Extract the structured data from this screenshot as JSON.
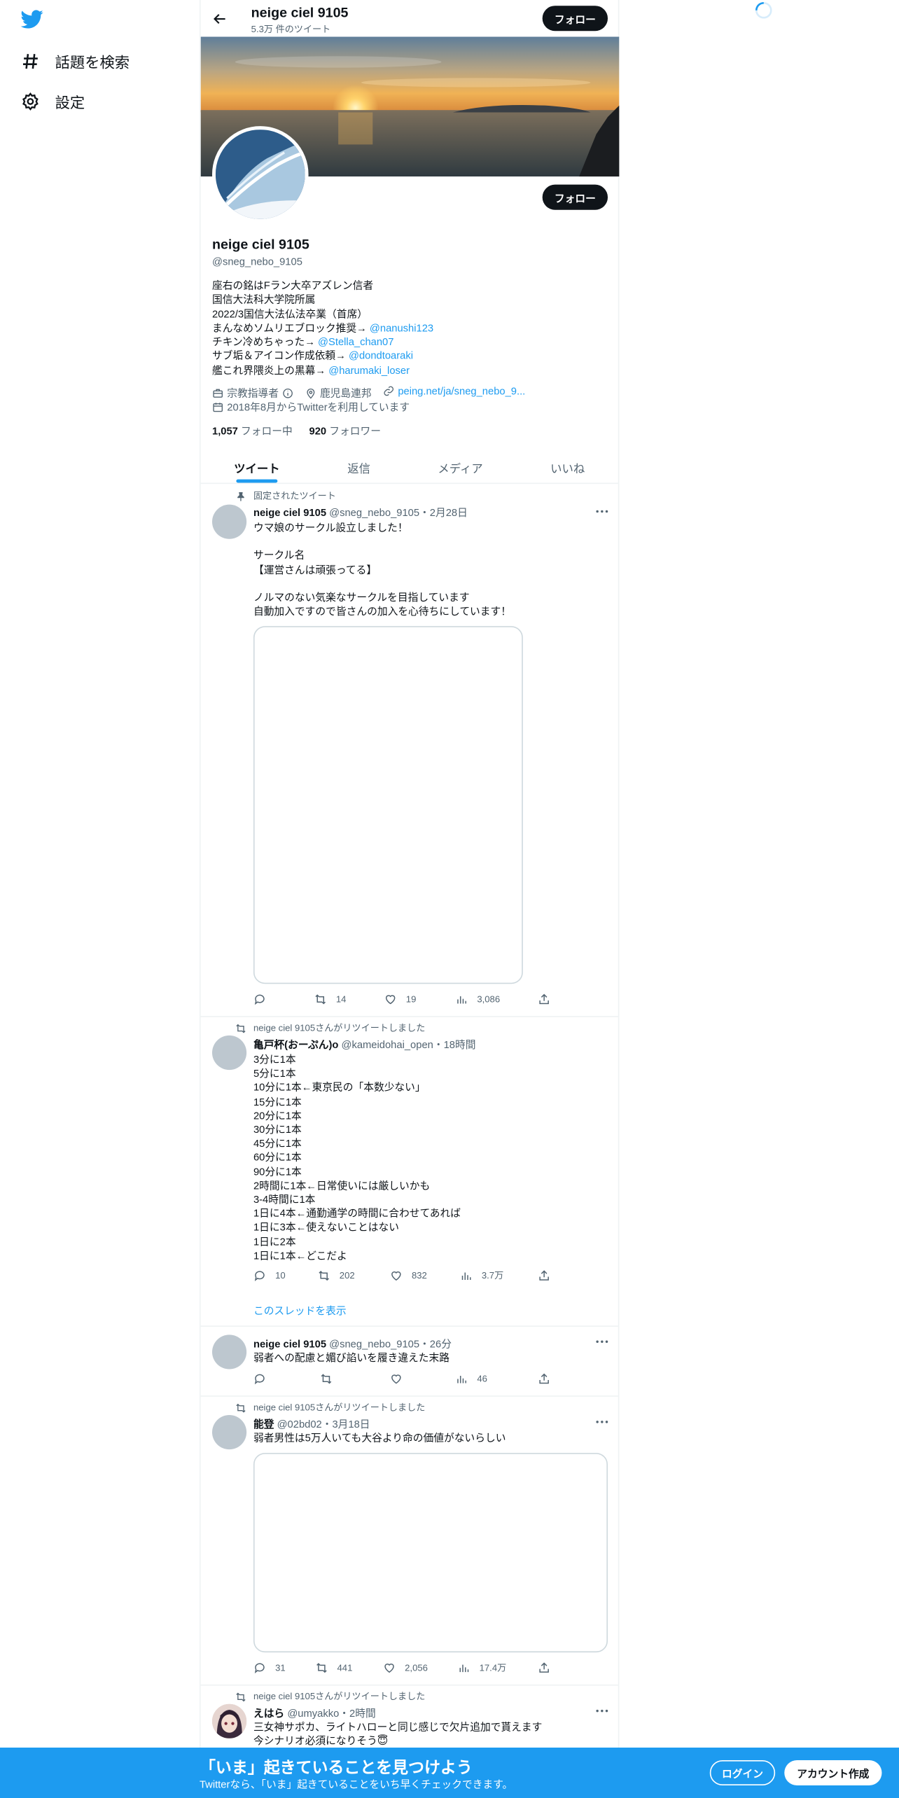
{
  "colors": {
    "accent": "#1d9bf0",
    "text": "#0f1419",
    "muted": "#536471",
    "border": "#eff3f4"
  },
  "nav": {
    "explore_label": "話題を検索",
    "settings_label": "設定"
  },
  "header": {
    "name": "neige ciel 9105",
    "tweet_count": "5.3万 件のツイート",
    "follow_label": "フォロー"
  },
  "profile": {
    "follow_label": "フォロー",
    "name": "neige ciel 9105",
    "handle": "@sneg_nebo_9105",
    "bio": {
      "l1": "座右の銘はFラン大卒アズレン信者",
      "l2": "国信大法科大学院所属",
      "l3": "2022/3国信大法仏法卒業（首席）",
      "l4_text": "まんなめソムリエブロック推奨→ ",
      "l4_link": "@nanushi123",
      "l5_text": "チキン冷めちゃった→ ",
      "l5_link": "@Stella_chan07",
      "l6_text": "サブ垢＆アイコン作成依頼→ ",
      "l6_link": "@dondtoaraki",
      "l7_text": "艦これ界隈炎上の黒幕→ ",
      "l7_link": "@harumaki_loser"
    },
    "category": "宗教指導者",
    "location": "鹿児島連邦",
    "url": "peing.net/ja/sneg_nebo_9...",
    "joined": "2018年8月からTwitterを利用しています",
    "following_count": "1,057",
    "following_label": "フォロー中",
    "followers_count": "920",
    "followers_label": "フォロワー"
  },
  "tabs": [
    "ツイート",
    "返信",
    "メディア",
    "いいね"
  ],
  "tweets": [
    {
      "context": "固定されたツイート",
      "name": "neige ciel 9105",
      "meta": "@sneg_nebo_9105・2月28日",
      "lines": [
        "ウマ娘のサークル設立しました！",
        "",
        "サークル名",
        "【運営さんは頑張ってる】",
        "",
        "ノルマのない気楽なサークルを目指しています",
        "自動加入ですので皆さんの加入を心待ちにしています！"
      ],
      "replies": "",
      "retweets": "14",
      "likes": "19",
      "views": "3,086"
    },
    {
      "context": "neige ciel 9105さんがリツイートしました",
      "name": "亀戸杯(おーぷん)o",
      "meta": "@kameidohai_open・18時間",
      "lines": [
        "3分に1本",
        "5分に1本",
        "10分に1本←東京民の「本数少ない」",
        "15分に1本",
        "20分に1本",
        "30分に1本",
        "45分に1本",
        "60分に1本",
        "90分に1本",
        "2時間に1本←日常使いには厳しいかも",
        "3-4時間に1本",
        "1日に4本←通勤通学の時間に合わせてあれば",
        "1日に3本←使えないことはない",
        "1日に2本",
        "1日に1本←どこだよ"
      ],
      "replies": "10",
      "retweets": "202",
      "likes": "832",
      "views": "3.7万",
      "thread_link": "このスレッドを表示"
    },
    {
      "name": "neige ciel 9105",
      "meta": "@sneg_nebo_9105・26分",
      "lines": [
        "弱者への配慮と媚び諂いを履き違えた末路"
      ],
      "replies": "",
      "retweets": "",
      "likes": "",
      "views": "46"
    },
    {
      "context": "neige ciel 9105さんがリツイートしました",
      "name": "能登",
      "meta": "@02bd02・3月18日",
      "lines": [
        "弱者男性は5万人いても大谷より命の価値がないらしい"
      ],
      "replies": "31",
      "retweets": "441",
      "likes": "2,056",
      "views": "17.4万"
    },
    {
      "context": "neige ciel 9105さんがリツイートしました",
      "name": "えはら",
      "meta": "@umyakko・2時間",
      "lines": [
        "三女神サポカ、ライトハローと同じ感じで欠片追加で貰えます",
        "今シナリオ必須になりそう😇"
      ]
    }
  ],
  "bottom_bar": {
    "title": "「いま」起きていることを見つけよう",
    "subtitle": "Twitterなら、「いま」起きていることをいち早くチェックできます。",
    "login_label": "ログイン",
    "signup_label": "アカウント作成"
  }
}
